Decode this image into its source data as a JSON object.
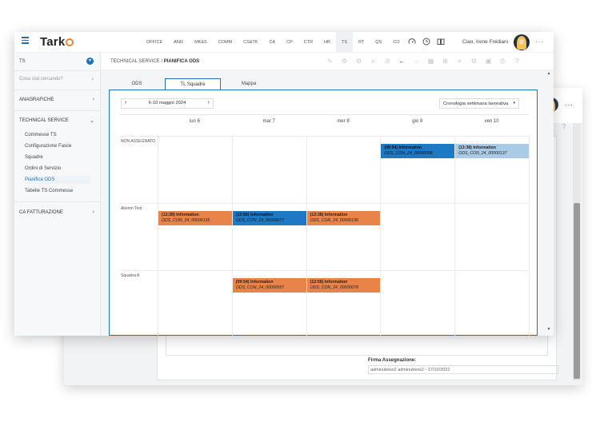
{
  "app": {
    "logo_text": "Tark"
  },
  "topbar": {
    "modules": [
      "OFFICE",
      "ANG",
      "MK&S",
      "COMM",
      "CS&TK",
      "CA",
      "CP",
      "CTR",
      "HR",
      "TS",
      "RT",
      "QS",
      "CO"
    ],
    "active_module": "TS",
    "greeting": "Ciao, Irene Frediani",
    "more": "···"
  },
  "sidebar": {
    "header": "TS",
    "search_placeholder": "Cosa stai cercando?",
    "sections": {
      "anagrafiche": "ANAGRAFICHE",
      "technical_service": "TECHNICAL SERVICE",
      "ca_fatturazione": "CA FATTURAZIONE"
    },
    "items": [
      "Commesse TS",
      "Configurazione Fasce",
      "Squadre",
      "Ordini di Servizio",
      "Pianifica ODS",
      "Tabelle TS Commesse"
    ],
    "active_item": "Pianifica ODS"
  },
  "breadcrumb": {
    "parent": "TECHNICAL SERVICE",
    "separator": "/",
    "current": "PIANIFICA ODS"
  },
  "tabs": [
    "ODS",
    "TL Squadre",
    "Mappa"
  ],
  "active_tab": "TL Squadre",
  "calendar": {
    "range_label": "6-10 maggio 2024",
    "view_label": "Cronologia settimana lavorativa",
    "days": [
      "lun 6",
      "mar 7",
      "mer 8",
      "gio 9",
      "ven 10"
    ],
    "rows": [
      "NON ASSEGNATO",
      "Akeron Test",
      "Squadra A"
    ],
    "events": [
      {
        "row": 0,
        "day": 3,
        "title": "(09:54) Information",
        "code": "ODS_CON_24_00000058",
        "color": "blue"
      },
      {
        "row": 0,
        "day": 4,
        "title": "(13:38) Information",
        "code": "ODS_CON_24_00000137",
        "color": "lightblue"
      },
      {
        "row": 1,
        "day": 0,
        "title": "(13:38) Information",
        "code": "ODS_CON_24_00000135",
        "color": "orange"
      },
      {
        "row": 1,
        "day": 1,
        "title": "(12:56) Information",
        "code": "ODS_CON_24_00000077",
        "color": "blue"
      },
      {
        "row": 1,
        "day": 2,
        "title": "(13:38) Information",
        "code": "ODS_CON_24_00000136",
        "color": "orange"
      },
      {
        "row": 2,
        "day": 1,
        "title": "(09:54) Information",
        "code": "ODS_CON_24_00000057",
        "color": "orange"
      },
      {
        "row": 2,
        "day": 2,
        "title": "(12:56) Information",
        "code": "ODS_CON_24_00000078",
        "color": "orange"
      }
    ]
  },
  "back_window": {
    "firma_label": "Firma Assegnazione:",
    "firma_value": "adminubess2 adminubess2 - 17/10/2022"
  },
  "colors": {
    "accent": "#1e73be",
    "orange": "#e8844a",
    "blue": "#1d79c3",
    "lightblue": "#a9cbe6"
  }
}
